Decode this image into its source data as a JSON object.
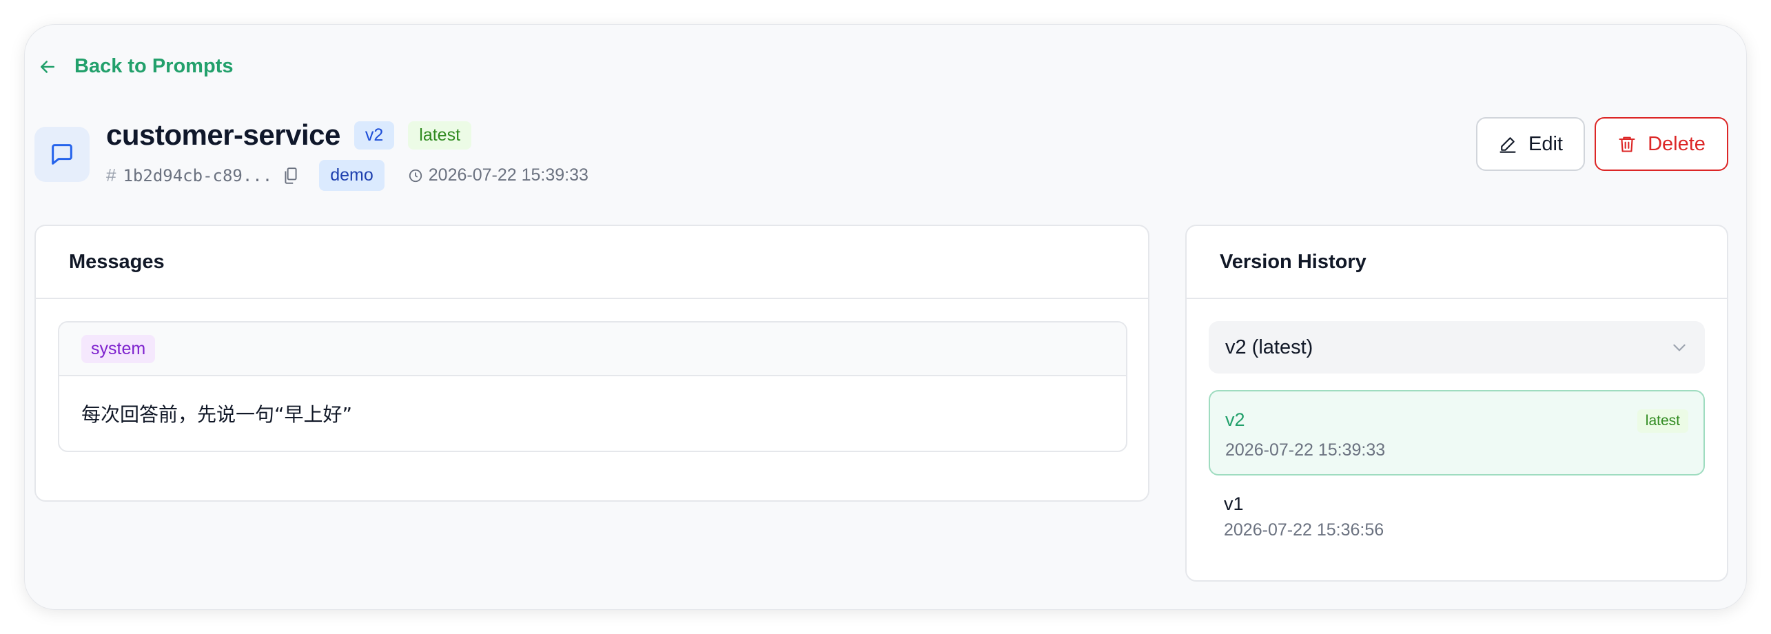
{
  "nav": {
    "back_label": "Back to Prompts"
  },
  "prompt": {
    "name": "customer-service",
    "version_badge": "v2",
    "latest_badge": "latest",
    "id_display": "1b2d94cb-c89...",
    "tag": "demo",
    "created_at": "2026-07-22 15:39:33"
  },
  "actions": {
    "edit_label": "Edit",
    "delete_label": "Delete"
  },
  "messages_card": {
    "title": "Messages",
    "messages": [
      {
        "role": "system",
        "content": "每次回答前，先说一句“早上好”"
      }
    ]
  },
  "versions_card": {
    "title": "Version History",
    "selected": "v2 (latest)",
    "versions": [
      {
        "label": "v2",
        "date": "2026-07-22 15:39:33",
        "badge": "latest",
        "active": true
      },
      {
        "label": "v1",
        "date": "2026-07-22 15:36:56",
        "active": false
      }
    ]
  },
  "colors": {
    "accent_green": "#22a06b",
    "danger_red": "#dc2626",
    "tag_blue_bg": "#dbeafe",
    "latest_green_bg": "#ecfbe6",
    "system_purple_bg": "#f5e8fd"
  },
  "icons": {
    "back": "arrow-left-icon",
    "prompt": "chat-bubble-icon",
    "id": "hash-icon",
    "copy": "copy-icon",
    "time": "clock-icon",
    "edit": "pencil-icon",
    "delete": "trash-icon",
    "select": "chevron-down-icon"
  }
}
